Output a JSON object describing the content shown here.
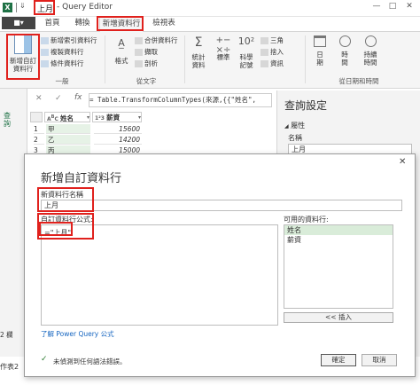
{
  "titlebar": {
    "app_icon": "excel-icon",
    "query_name": "上月",
    "title_rest": "- Query Editor",
    "win_minimize": "—",
    "win_maximize": "□",
    "win_close": "✕"
  },
  "tabs": {
    "file": "■▾",
    "home": "首頁",
    "transform": "轉換",
    "add_column": "新增資料行",
    "view": "檢視表"
  },
  "ribbon": {
    "custom_column": "新增自訂\n資料行",
    "add_index": "新增索引資料行",
    "duplicate": "複製資料行",
    "conditional": "條件資料行",
    "group_general": "一般",
    "format": "格式",
    "merge": "合併資料行",
    "extract": "擷取",
    "parse": "剖析",
    "group_text": "從文字",
    "stats": "統計\n資料",
    "standard": "標準",
    "scientific": "科學\n記號",
    "trig": "三角",
    "round": "捨入",
    "info": "資訊",
    "date": "日\n期",
    "time": "時\n間",
    "duration": "持續\n時間",
    "group_datetime": "從日期和時間"
  },
  "formula_bar": {
    "cancel": "✕",
    "accept": "✓",
    "fx": "fx",
    "formula": "= Table.TransformColumnTypes(來源,{{\"姓名\","
  },
  "nav_label": "查詢",
  "grid": {
    "col_name": "姓名",
    "col_salary": "薪資",
    "rows": [
      {
        "num": "1",
        "name": "甲",
        "salary": "15600"
      },
      {
        "num": "2",
        "name": "乙",
        "salary": "14200"
      },
      {
        "num": "3",
        "name": "丙",
        "salary": "15000"
      }
    ]
  },
  "query_settings": {
    "title": "查詢設定",
    "properties": "屬性",
    "name_label": "名稱",
    "name_value": "上月"
  },
  "statusbar": {
    "left": "2 欄",
    "sheet": "作表2"
  },
  "dialog": {
    "title": "新增自訂資料行",
    "new_col_label": "新資料行名稱",
    "new_col_value": "上月",
    "formula_label": "自訂資料行公式:",
    "formula_value": "=\"上月\"",
    "available_label": "可用的資料行:",
    "available": [
      "姓名",
      "薪資"
    ],
    "insert_btn": "<< 插入",
    "learn_link": "了解 Power Query 公式",
    "status": "未偵測到任何語法錯誤。",
    "ok": "確定",
    "cancel": "取消"
  }
}
